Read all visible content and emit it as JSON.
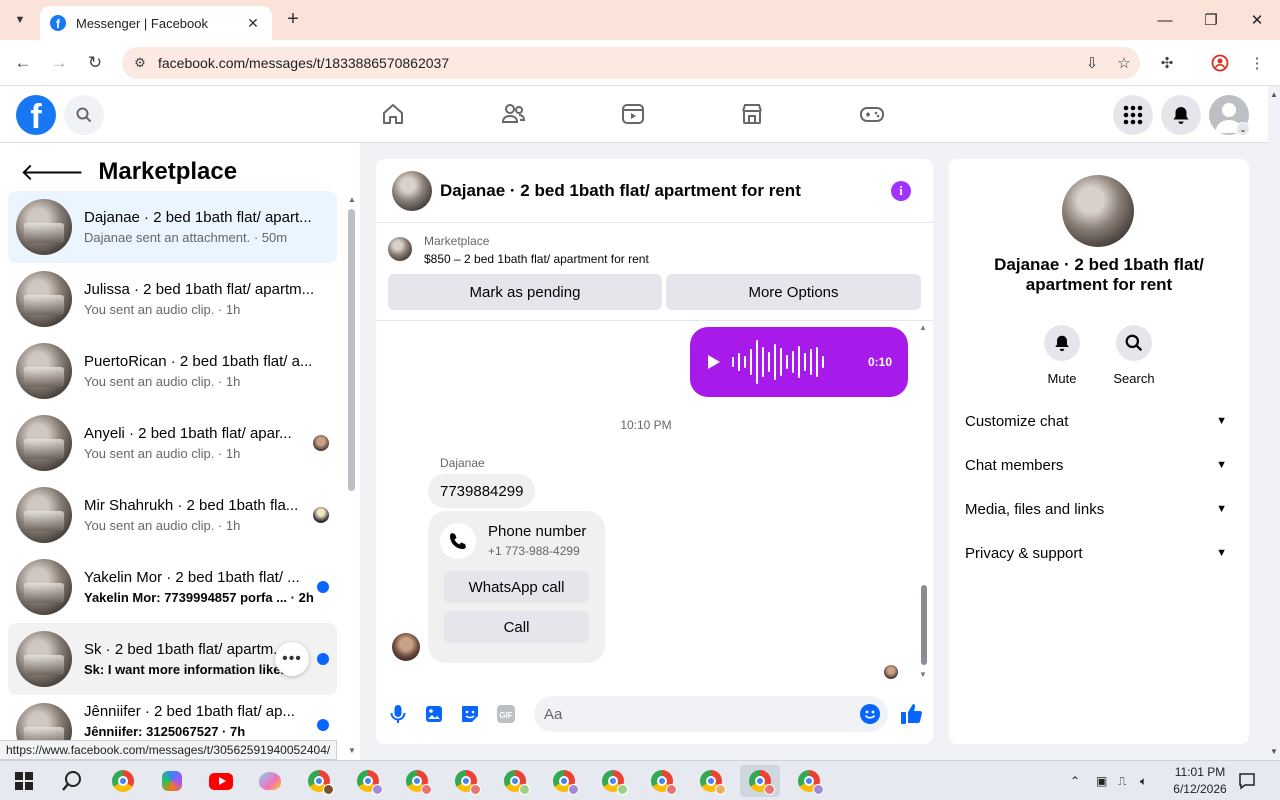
{
  "browser": {
    "tab_title": "Messenger | Facebook",
    "url": "facebook.com/messages/t/1833886570862037",
    "status_url": "https://www.facebook.com/messages/t/30562591940052404/"
  },
  "sidebar": {
    "title": "Marketplace",
    "conversations": [
      {
        "title": "Dajanae · 2 bed 1bath flat/ apart...",
        "subtitle": "Dajanae sent an attachment. · 50m"
      },
      {
        "title": "Julissa · 2 bed 1bath flat/ apartm...",
        "subtitle": "You sent an audio clip. · 1h"
      },
      {
        "title": "PuertoRican · 2 bed 1bath flat/ a...",
        "subtitle": "You sent an audio clip. · 1h"
      },
      {
        "title": "Anyeli · 2 bed 1bath flat/ apar...",
        "subtitle": "You sent an audio clip. · 1h"
      },
      {
        "title": "Mir Shahrukh · 2 bed 1bath fla...",
        "subtitle": "You sent an audio clip. · 1h"
      },
      {
        "title": "Yakelin Mor · 2 bed 1bath flat/ ...",
        "subtitle": "Yakelin Mor: 7739994857 porfa ... · 2h"
      },
      {
        "title": "Sk · 2 bed 1bath flat/ apartm...",
        "subtitle": "Sk: I want more information like..."
      },
      {
        "title": "Jênniifer · 2 bed 1bath flat/ ap...",
        "subtitle": "Jênniifer: 3125067527 · 7h"
      }
    ]
  },
  "chat": {
    "title": "Dajanae · 2 bed 1bath flat/ apartment for rent",
    "marketplace_label": "Marketplace",
    "listing": "$850 – 2 bed 1bath flat/ apartment for rent",
    "mark_pending": "Mark as pending",
    "more_options": "More Options",
    "audio_duration": "0:10",
    "time_separator": "10:10 PM",
    "sender": "Dajanae",
    "number_message": "7739884299",
    "phone_card_title": "Phone number",
    "phone_card_number": "+1 773-988-4299",
    "whatsapp_call": "WhatsApp call",
    "call": "Call",
    "input_placeholder": "Aa"
  },
  "details": {
    "name": "Dajanae · 2 bed 1bath flat/ apartment for rent",
    "mute": "Mute",
    "search": "Search",
    "sections": [
      "Customize chat",
      "Chat members",
      "Media, files and links",
      "Privacy & support"
    ]
  },
  "taskbar": {
    "time": "11:01 PM",
    "date": "6/12/2026"
  },
  "colors": {
    "facebook_blue": "#1877f2",
    "messenger_purple": "#a033ff",
    "unread_dot": "#0866ff"
  }
}
